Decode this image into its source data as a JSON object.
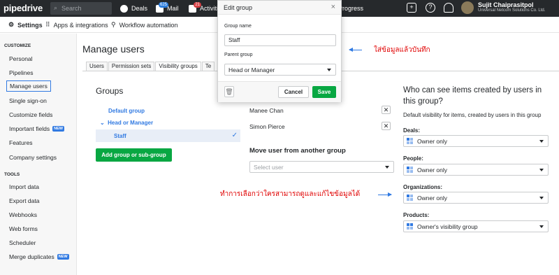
{
  "topbar": {
    "logo": "pipedrive",
    "search_placeholder": "Search",
    "nav": [
      {
        "label": "Deals",
        "badge": ""
      },
      {
        "label": "Mail",
        "badge": "625"
      },
      {
        "label": "Activities",
        "badge": "21"
      },
      {
        "label": "Progress",
        "badge": ""
      }
    ],
    "user_name": "Sujit Chaiprasitpol",
    "user_company": "Universal Netcom Solutions Co. Ltd."
  },
  "subbar": {
    "settings": "Settings",
    "apps": "Apps & integrations",
    "workflow": "Workflow automation"
  },
  "sidebar": {
    "customize_heading": "CUSTOMIZE",
    "customize_items": [
      "Personal",
      "Pipelines",
      "Manage users",
      "Single sign-on",
      "Customize fields",
      "Important fields",
      "Features",
      "Company settings"
    ],
    "tools_heading": "TOOLS",
    "tools_items": [
      "Import data",
      "Export data",
      "Webhooks",
      "Web forms",
      "Scheduler",
      "Merge duplicates"
    ],
    "new_label": "NEW"
  },
  "page": {
    "title": "Manage users",
    "tabs": [
      "Users",
      "Permission sets",
      "Visibility groups",
      "Te"
    ]
  },
  "groups": {
    "heading": "Groups",
    "default_group": "Default group",
    "head_group": "Head or Manager",
    "staff": "Staff",
    "add_button": "Add group or sub-group"
  },
  "members": {
    "list": [
      "Manee Chan",
      "Simon Pierce"
    ],
    "move_heading": "Move user from another group",
    "select_placeholder": "Select user"
  },
  "visibility": {
    "heading": "Who can see items created by users in this group?",
    "description": "Default visibility for items, created by users in this group",
    "fields": [
      {
        "label": "Deals:",
        "value": "Owner only"
      },
      {
        "label": "People:",
        "value": "Owner only"
      },
      {
        "label": "Organizations:",
        "value": "Owner only"
      },
      {
        "label": "Products:",
        "value": "Owner's visibility group"
      }
    ]
  },
  "modal": {
    "title": "Edit group",
    "group_name_label": "Group name",
    "group_name_value": "Staff",
    "parent_label": "Parent group",
    "parent_value": "Head or Manager",
    "cancel": "Cancel",
    "save": "Save"
  },
  "annotations": {
    "save_note": "ใส่ข้อมูลแล้วบันทึก",
    "visibility_note": "ทำการเลือกว่าใครสามารถดูและแก้ไขข้อมูลได้"
  },
  "colors": {
    "accent": "#317ae2",
    "green": "#08a742",
    "annotation": "#e00000"
  }
}
